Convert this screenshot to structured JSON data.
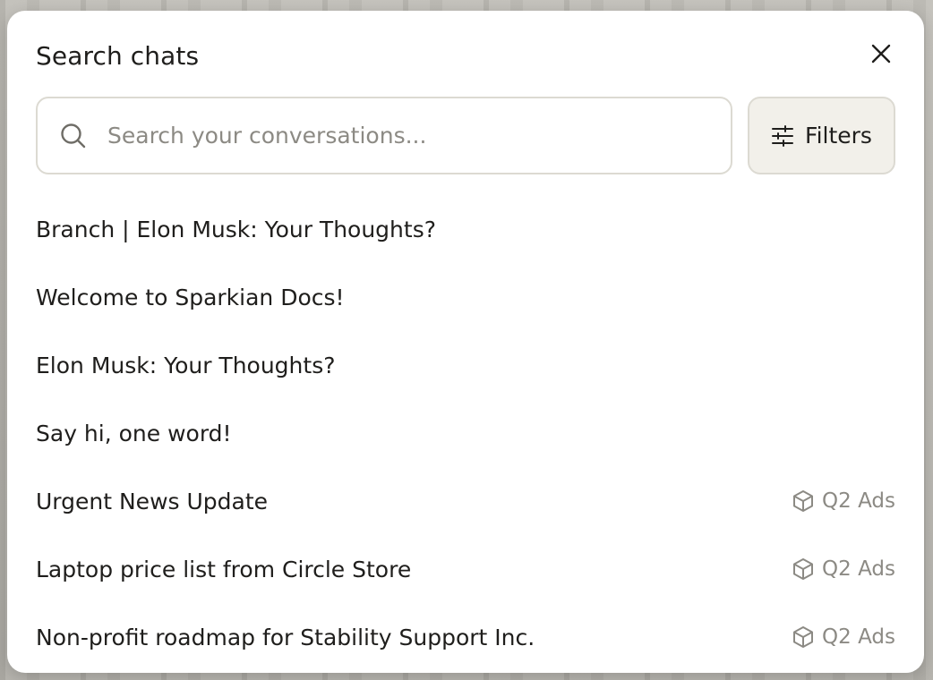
{
  "dialog": {
    "title": "Search chats",
    "close_icon": "close-icon"
  },
  "search": {
    "placeholder": "Search your conversations...",
    "value": "",
    "icon": "search-icon"
  },
  "filters": {
    "label": "Filters",
    "icon": "sliders-icon"
  },
  "results": [
    {
      "title": "Branch | Elon Musk: Your Thoughts?",
      "project": ""
    },
    {
      "title": "Welcome to Sparkian Docs!",
      "project": ""
    },
    {
      "title": "Elon Musk: Your Thoughts?",
      "project": ""
    },
    {
      "title": "Say hi, one word!",
      "project": ""
    },
    {
      "title": "Urgent News Update",
      "project": "Q2 Ads",
      "project_icon": "box-icon"
    },
    {
      "title": "Laptop price list from Circle Store",
      "project": "Q2 Ads",
      "project_icon": "box-icon"
    },
    {
      "title": "Non-profit roadmap for Stability Support Inc.",
      "project": "Q2 Ads",
      "project_icon": "box-icon"
    }
  ],
  "colors": {
    "text": "#1f1e1c",
    "muted": "#8c8a84",
    "border": "#dcdad2",
    "button_bg": "#f2f0ea"
  }
}
